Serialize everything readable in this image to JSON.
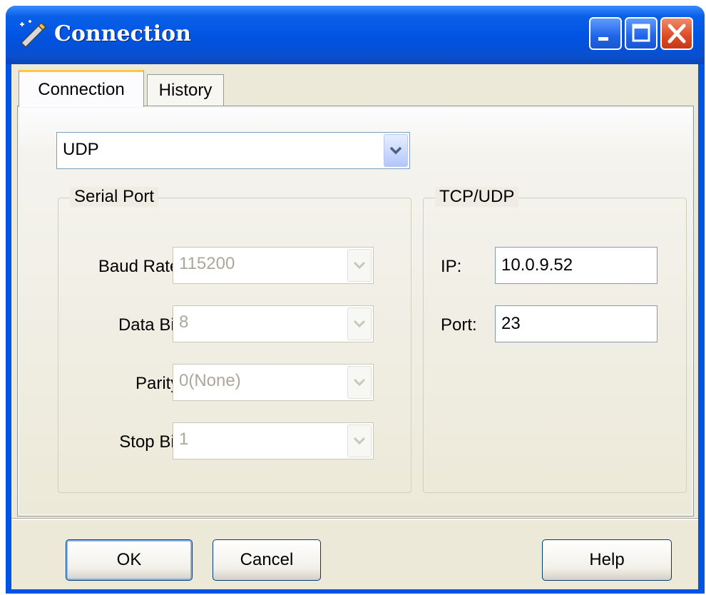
{
  "window": {
    "title": "Connection",
    "icon": "wand-connection-icon"
  },
  "tabs": [
    {
      "label": "Connection",
      "active": true
    },
    {
      "label": "History",
      "active": false
    }
  ],
  "connection_type": {
    "value": "UDP"
  },
  "serial_port": {
    "title": "Serial Port",
    "fields": [
      {
        "label": "Baud Rate:",
        "value": "115200"
      },
      {
        "label": "Data Bit:",
        "value": "8"
      },
      {
        "label": "Parity:",
        "value": "0(None)"
      },
      {
        "label": "Stop Bit:",
        "value": "1"
      }
    ]
  },
  "tcp_udp": {
    "title": "TCP/UDP",
    "ip_label": "IP:",
    "ip_value": "10.0.9.52",
    "port_label": "Port:",
    "port_value": "23"
  },
  "buttons": {
    "ok": "OK",
    "cancel": "Cancel",
    "help": "Help"
  },
  "colors": {
    "titlebar": "#0054e3",
    "face": "#ece9d8",
    "disabled_text": "#aca899",
    "close_button": "#dc4a24"
  }
}
